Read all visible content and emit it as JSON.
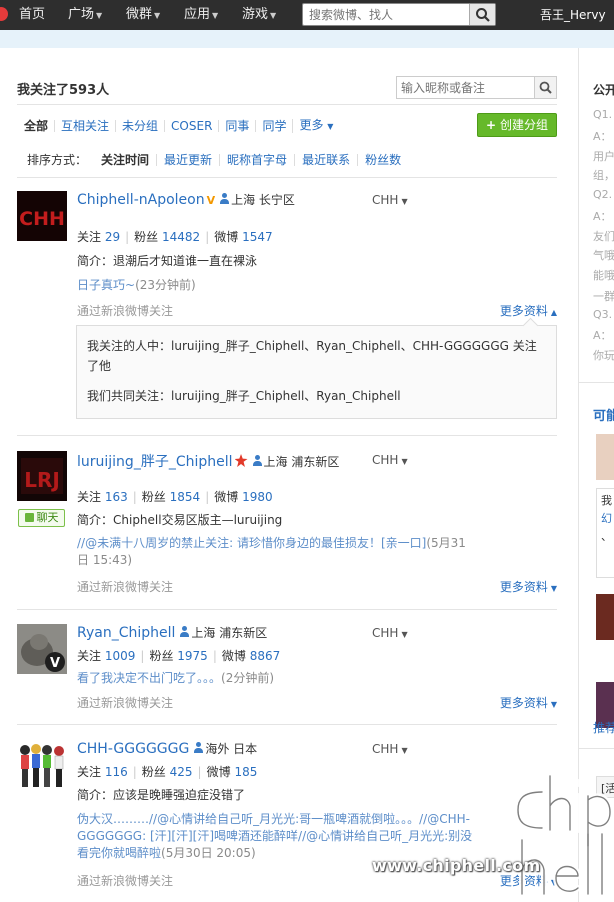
{
  "nav": {
    "items": [
      "首页",
      "广场",
      "微群",
      "应用",
      "游戏"
    ],
    "has_dropdown": [
      false,
      true,
      true,
      true,
      true
    ],
    "search_placeholder": "搜索微博、找人",
    "user": "吾王_Hervy"
  },
  "header": {
    "title": "我关注了593人",
    "note_search_placeholder": "输入昵称或备注"
  },
  "group_tabs": [
    "全部",
    "互相关注",
    "未分组",
    "COSER",
    "同事",
    "同学",
    "更多"
  ],
  "create_group_label": "创建分组",
  "sort": {
    "label": "排序方式：",
    "options": [
      "关注时间",
      "最近更新",
      "昵称首字母",
      "最近联系",
      "粉丝数"
    ],
    "active": "关注时间"
  },
  "follows": [
    {
      "name": "Chiphell-nApoleon",
      "location": "上海 长宁区",
      "group": "CHH",
      "following_label": "关注",
      "following": "29",
      "fans_label": "粉丝",
      "fans": "14482",
      "weibo_label": "微博",
      "weibo": "1547",
      "bio": "简介：退潮后才知道谁一直在裸泳",
      "latest_text": "日子真巧~",
      "latest_time": "(23分钟前)",
      "via": "通过新浪微博关注",
      "more_info": "更多资料",
      "expanded_line1": "我关注的人中：luruijing_胖子_Chiphell、Ryan_Chiphell、CHH-GGGGGGG 关注了他",
      "expanded_line2": "我们共同关注：luruijing_胖子_Chiphell、Ryan_Chiphell"
    },
    {
      "name": "luruijing_胖子_Chiphell",
      "location": "上海 浦东新区",
      "group": "CHH",
      "following_label": "关注",
      "following": "163",
      "fans_label": "粉丝",
      "fans": "1854",
      "weibo_label": "微博",
      "weibo": "1980",
      "chat": "聊天",
      "bio": "简介：Chiphell交易区版主—luruijing",
      "latest_text": "//@未满十八周岁的禁止关注: 请珍惜你身边的最佳损友！[亲一口]",
      "latest_time": "(5月31日 15:43)",
      "via": "通过新浪微博关注",
      "more_info": "更多资料"
    },
    {
      "name": "Ryan_Chiphell",
      "location": "上海 浦东新区",
      "group": "CHH",
      "following_label": "关注",
      "following": "1009",
      "fans_label": "粉丝",
      "fans": "1975",
      "weibo_label": "微博",
      "weibo": "8867",
      "latest_text": "看了我决定不出门吃了。。。",
      "latest_time": "(2分钟前)",
      "via": "通过新浪微博关注",
      "more_info": "更多资料"
    },
    {
      "name": "CHH-GGGGGGG",
      "location": "海外 日本",
      "group": "CHH",
      "following_label": "关注",
      "following": "116",
      "fans_label": "粉丝",
      "fans": "425",
      "weibo_label": "微博",
      "weibo": "185",
      "bio": "简介：应该是晚睡强迫症没错了",
      "latest_text": "伪大汉………//@心情讲给自己听_月光光:哥一瓶啤酒就倒啦。。。//@CHH-GGGGGGG: [汗][汗][汗]喝啤酒还能醉咩//@心情讲给自己听_月光光:别没看完你就喝醉啦",
      "latest_time": "(5月30日 20:05)",
      "via": "通过新浪微博关注",
      "more_info": "更多资料"
    }
  ],
  "right_column": {
    "title": "公开",
    "faq_lines": [
      "Q1.",
      "A：",
      "用户",
      "组，",
      "Q2.",
      "A：",
      "友们",
      "气哦",
      "能哦",
      "一群",
      "Q3.",
      "A：",
      "你玩"
    ],
    "title2": "可能",
    "card_lines": [
      "我",
      "幻",
      "、"
    ],
    "link": "推荐",
    "bottom_label": "[活"
  },
  "watermark": {
    "logo": "chip hell",
    "url": "www.chiphell.com"
  }
}
